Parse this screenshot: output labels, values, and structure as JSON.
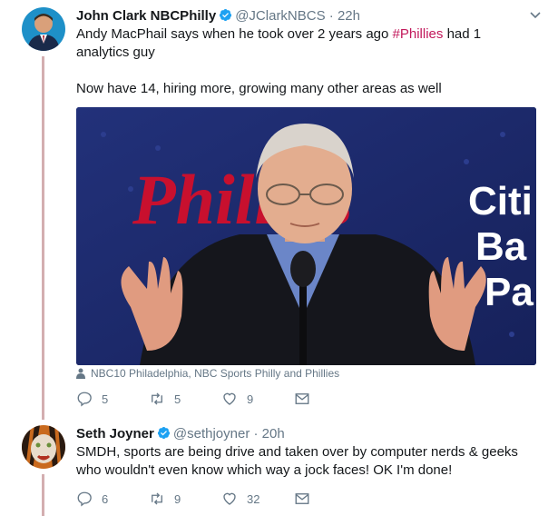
{
  "tweets": [
    {
      "author_name": "John Clark NBCPhilly",
      "handle": "@JClarkNBCS",
      "time": "22h",
      "text_before_hashtag": "Andy MacPhail says when he took over 2 years ago ",
      "hashtag": "#Phillies",
      "text_after_hashtag": " had 1 analytics guy",
      "text_second_paragraph": "Now have 14, hiring more, growing many other areas as well",
      "media_credit": "NBC10 Philadelphia, NBC Sports Philly and Phillies",
      "media_backdrop_text": {
        "left": "Phillies",
        "right_line1": "Citi",
        "right_line2": "Ba",
        "right_line3": "Pa"
      },
      "replies": "5",
      "retweets": "5",
      "likes": "9",
      "verified": true
    },
    {
      "author_name": "Seth Joyner",
      "handle": "@sethjoyner",
      "time": "20h",
      "text": "SMDH, sports are being drive and taken over by computer nerds & geeks who wouldn't even know which way a jock faces! OK I'm done!",
      "replies": "6",
      "retweets": "9",
      "likes": "32",
      "verified": true
    }
  ],
  "colors": {
    "thread_line": "#d3aeb0",
    "verified_blue": "#1da1f2",
    "hashtag": "#c2185b",
    "secondary_text": "#657786"
  }
}
